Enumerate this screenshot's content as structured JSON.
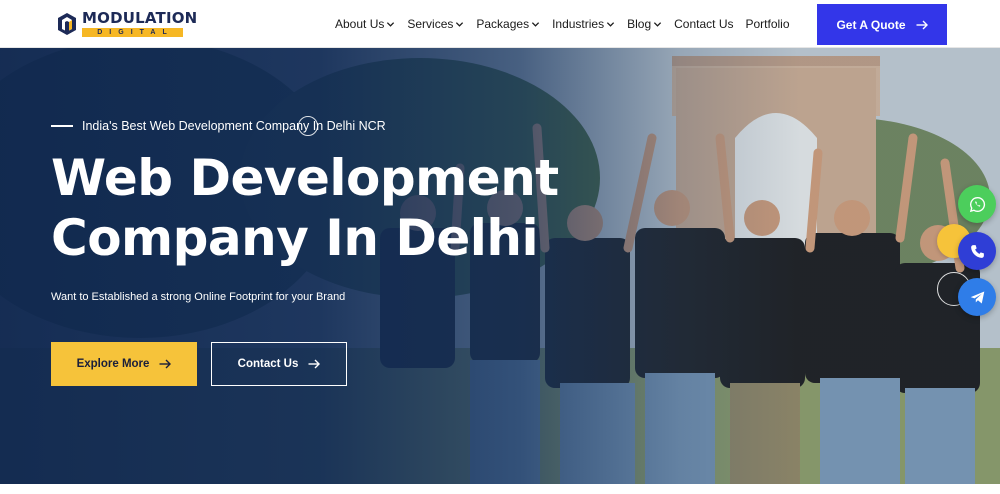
{
  "logo": {
    "title": "MODULATION",
    "subtitle": "DIGITAL"
  },
  "nav": {
    "items": [
      {
        "label": "About Us",
        "has_dropdown": true
      },
      {
        "label": "Services",
        "has_dropdown": true
      },
      {
        "label": "Packages",
        "has_dropdown": true
      },
      {
        "label": "Industries",
        "has_dropdown": true
      },
      {
        "label": "Blog",
        "has_dropdown": true
      },
      {
        "label": "Contact Us",
        "has_dropdown": false
      },
      {
        "label": "Portfolio",
        "has_dropdown": false
      }
    ],
    "cta_label": "Get A Quote"
  },
  "hero": {
    "tagline": "India's Best Web Development Company In Delhi NCR",
    "headline_line1": "Web Development",
    "headline_line2": "Company In Delhi",
    "subtext": "Want to Established a strong Online Footprint for your Brand",
    "primary_button": "Explore More",
    "secondary_button": "Contact Us"
  },
  "floating_actions": [
    {
      "icon": "whatsapp-icon",
      "color": "#4cce5c"
    },
    {
      "icon": "phone-icon",
      "color": "#2f3ed6"
    },
    {
      "icon": "telegram-icon",
      "color": "#2f7de8"
    }
  ],
  "colors": {
    "brand_navy": "#1d2a57",
    "accent_yellow": "#f6c33a",
    "cta_blue": "#3336e9"
  }
}
